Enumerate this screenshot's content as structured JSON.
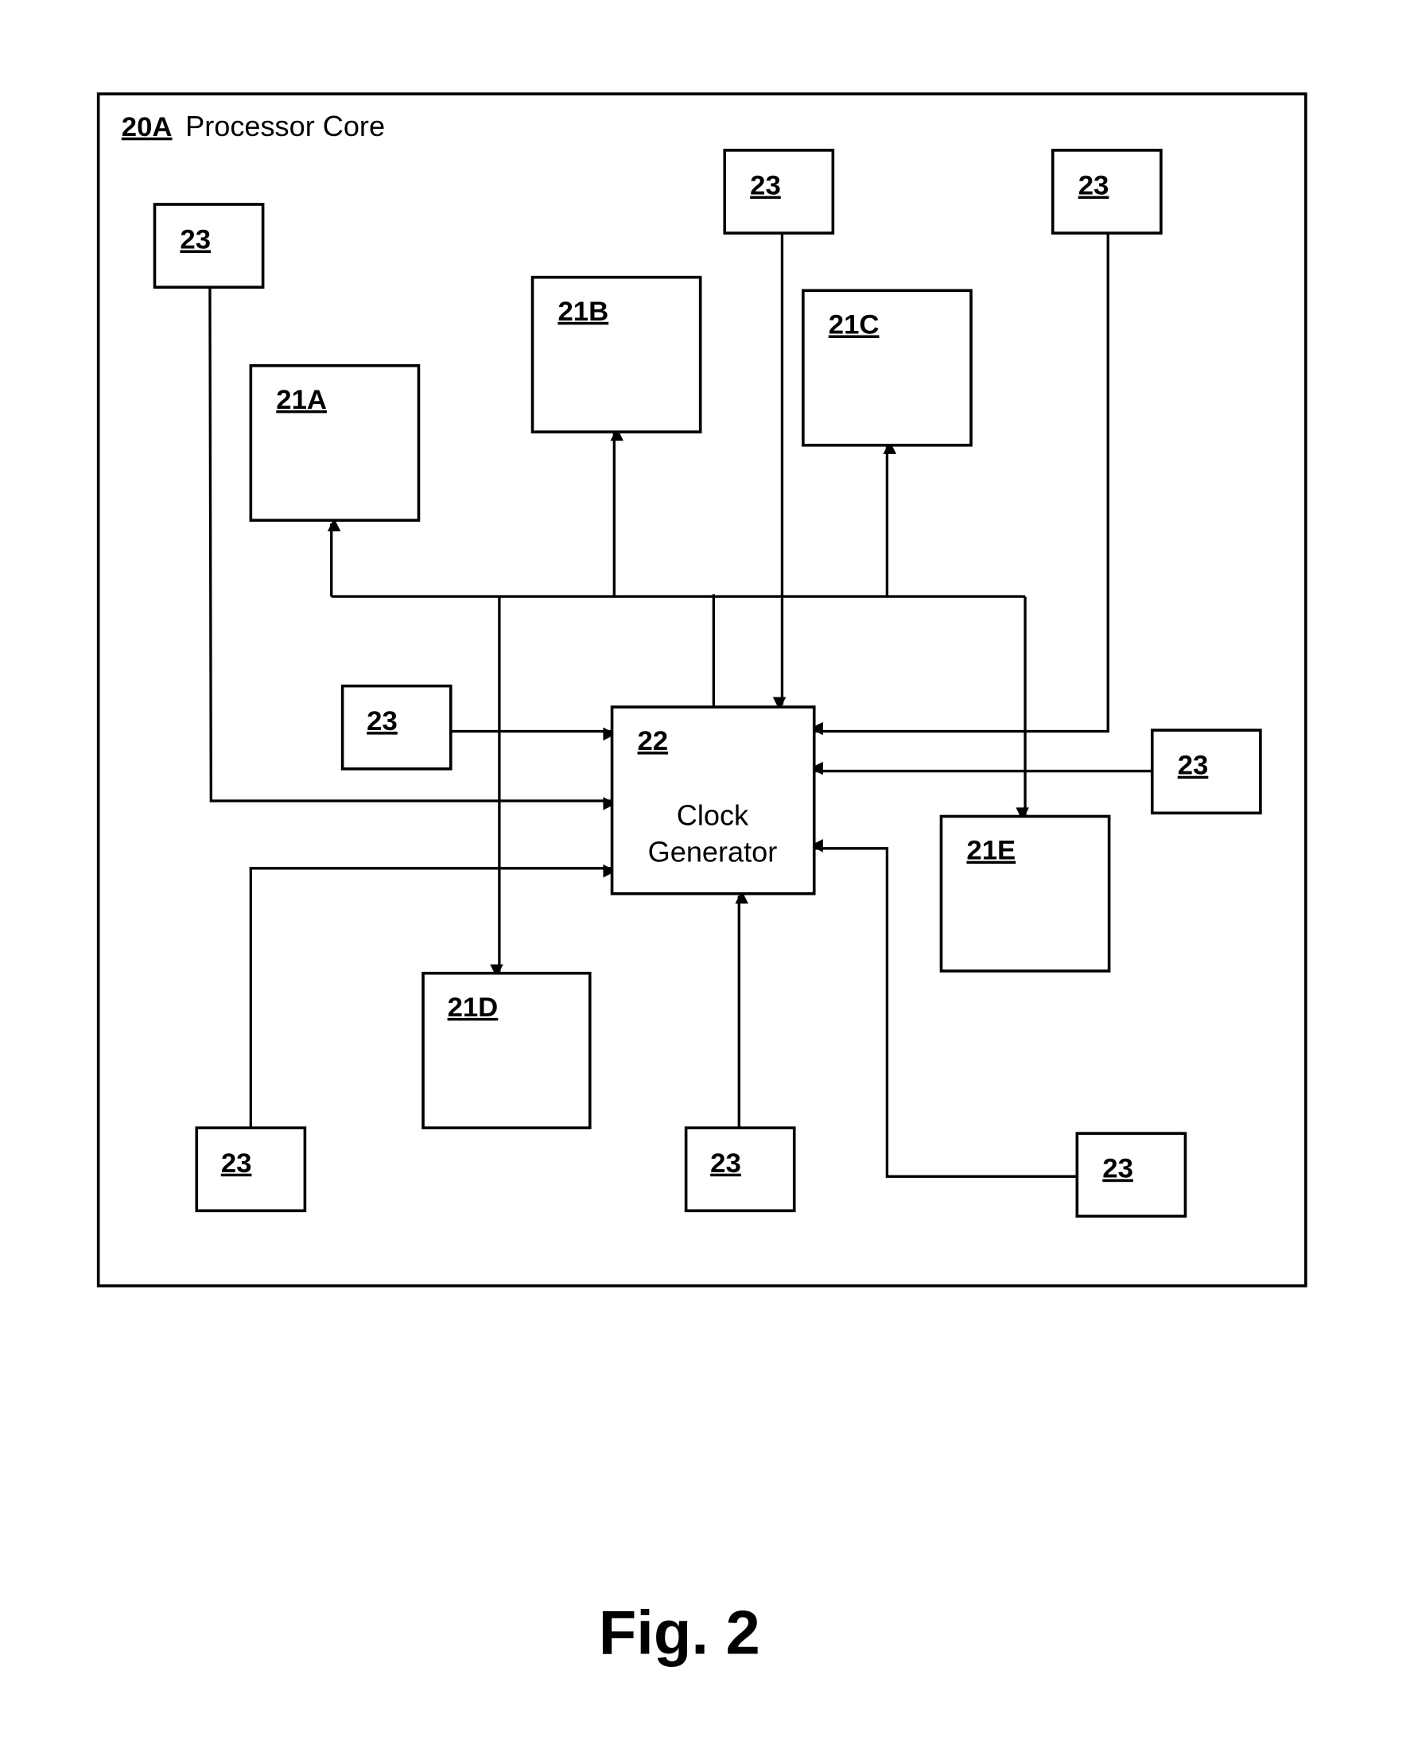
{
  "diagram": {
    "container": {
      "ref": "20A",
      "title": "Processor Core"
    },
    "clock_generator": {
      "ref": "22",
      "line1": "Clock",
      "line2": "Generator"
    },
    "units": [
      {
        "ref": "21A"
      },
      {
        "ref": "21B"
      },
      {
        "ref": "21C"
      },
      {
        "ref": "21D"
      },
      {
        "ref": "21E"
      }
    ],
    "sensors": [
      {
        "ref": "23"
      },
      {
        "ref": "23"
      },
      {
        "ref": "23"
      },
      {
        "ref": "23"
      },
      {
        "ref": "23"
      },
      {
        "ref": "23"
      },
      {
        "ref": "23"
      },
      {
        "ref": "23"
      }
    ],
    "connections": [
      {
        "from": "23 (top-left)",
        "to": "22"
      },
      {
        "from": "23 (top-center)",
        "to": "22"
      },
      {
        "from": "23 (top-right)",
        "to": "22"
      },
      {
        "from": "23 (mid-left)",
        "to": "22"
      },
      {
        "from": "23 (mid-right)",
        "to": "22"
      },
      {
        "from": "23 (bottom-left)",
        "to": "22"
      },
      {
        "from": "23 (bottom-center)",
        "to": "22"
      },
      {
        "from": "23 (bottom-right)",
        "to": "22"
      },
      {
        "from": "22",
        "to": "21A"
      },
      {
        "from": "22",
        "to": "21B"
      },
      {
        "from": "22",
        "to": "21C"
      },
      {
        "from": "22",
        "to": "21D"
      },
      {
        "from": "22",
        "to": "21E"
      }
    ]
  },
  "figure_label": "Fig. 2"
}
